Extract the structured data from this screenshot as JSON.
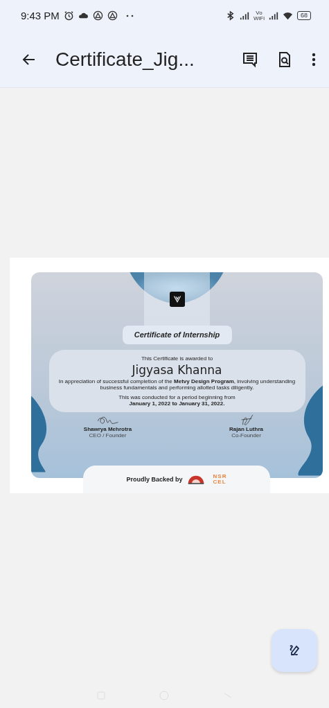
{
  "status_bar": {
    "time": "9:43 PM",
    "network_label": "Vo\nWiFi",
    "battery": "68"
  },
  "app_bar": {
    "title": "Certificate_Jig..."
  },
  "certificate": {
    "heading": "Certificate of Internship",
    "awarded_line": "This Certificate is awarded to",
    "recipient": "Jigyasa Khanna",
    "description": "In appreciation of successful completion of the **Metvy Design Program**, involving understanding business fundamentals and performing allotted tasks diligently.",
    "period_line": "This was conducted for a period beginning from",
    "period_dates": "January 1, 2022 to January 31, 2022.",
    "signatories": [
      {
        "name": "Shawrya Mehrotra",
        "role": "CEO / Founder"
      },
      {
        "name": "Rajan Luthra",
        "role": "Co-Founder"
      }
    ],
    "backed_label": "Proudly Backed by",
    "backer_logo_text": [
      "NSR",
      "CEL"
    ]
  }
}
